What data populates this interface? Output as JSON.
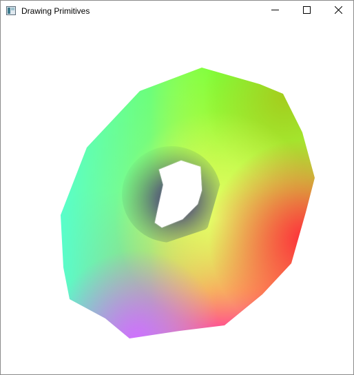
{
  "window": {
    "title": "Drawing Primitives",
    "icon": "app-window-icon",
    "controls": {
      "minimize_icon": "minimize-icon",
      "maximize_icon": "maximize-icon",
      "close_icon": "close-icon"
    }
  },
  "scene": {
    "object": "torus",
    "shading": "vertex-color gradient",
    "background": "#ffffff",
    "colors": {
      "top": "#7aff3a",
      "right": "#c8e82a",
      "lower_right": "#ff3a5a",
      "bottom": "#cf6dff",
      "left": "#55ffd0",
      "upper_left": "#33ff88",
      "center_highlight": "#ddff6a",
      "hole_shadow": "#4a2a9a"
    }
  }
}
